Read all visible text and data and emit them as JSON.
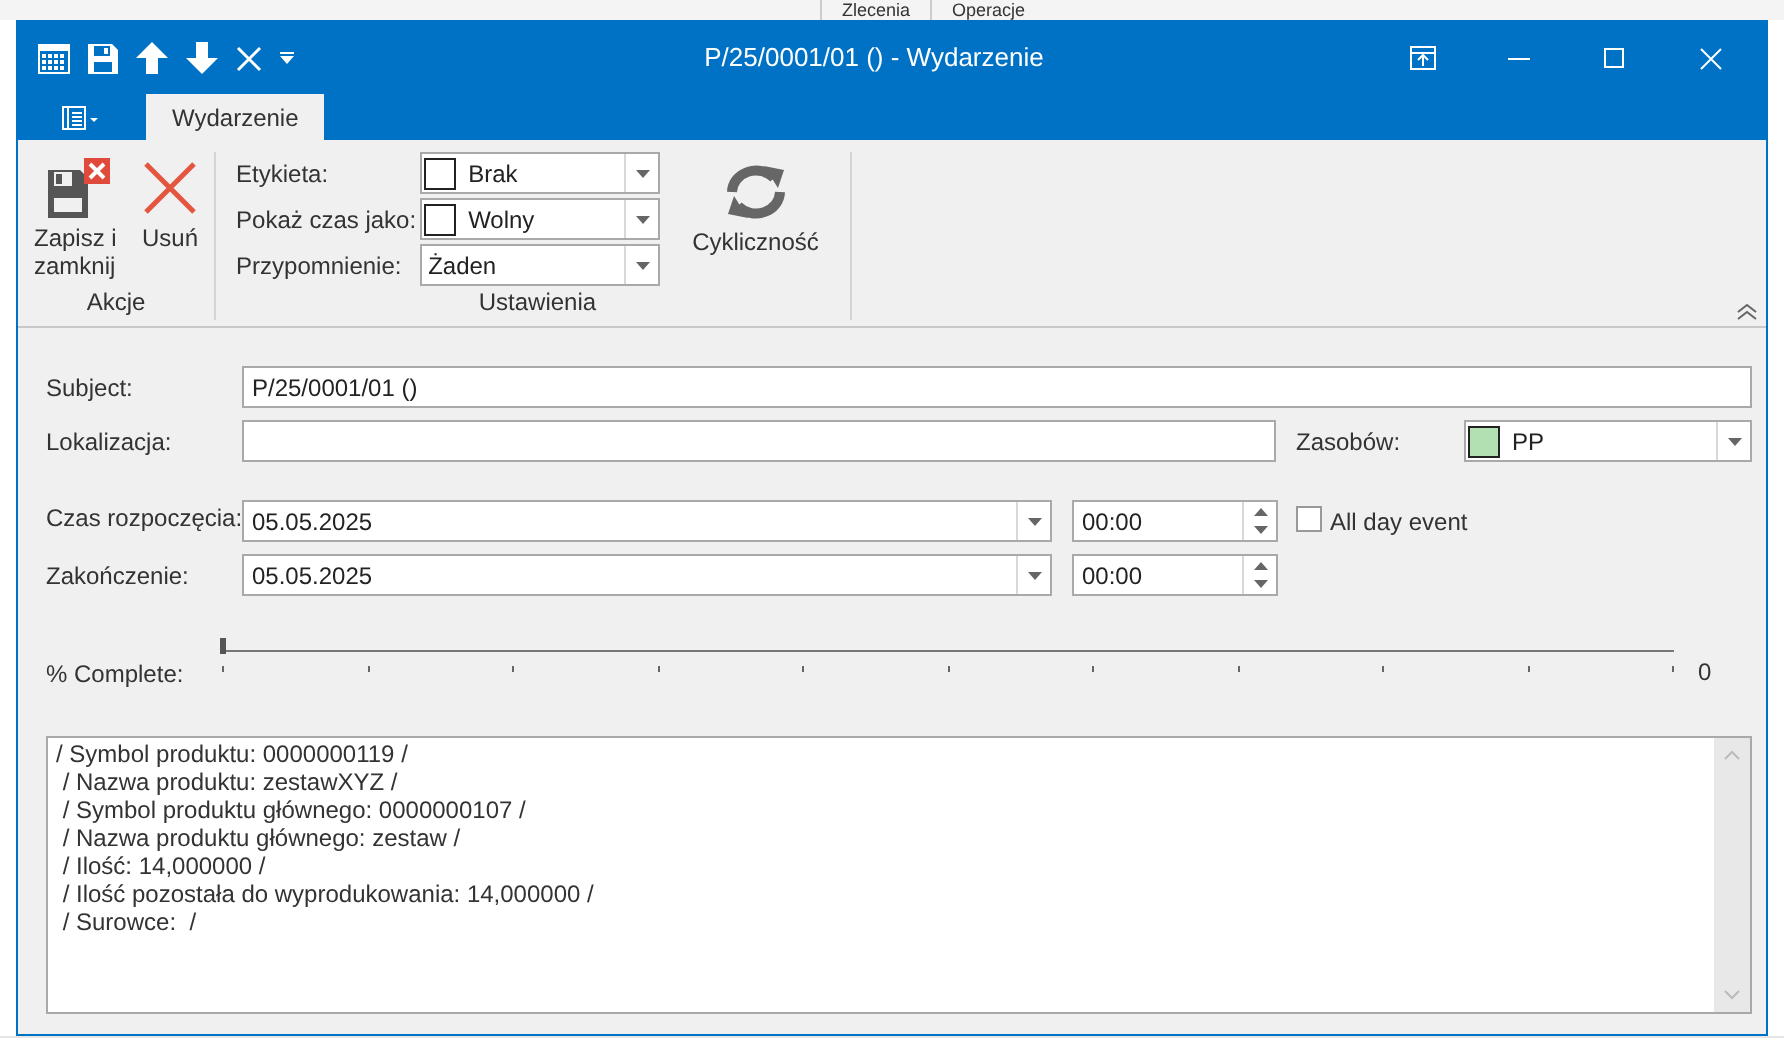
{
  "background": {
    "tabs": [
      "Zlecenia",
      "Operacje"
    ]
  },
  "window": {
    "title": "P/25/0001/01 () - Wydarzenie"
  },
  "ribbon": {
    "tabs": [
      {
        "label": "Wydarzenie",
        "selected": true
      }
    ],
    "groups": [
      {
        "title": "Akcje",
        "buttons": [
          {
            "kind": "save-close",
            "label": "Zapisz i zamknij"
          },
          {
            "kind": "delete",
            "label": "Usuń"
          }
        ]
      },
      {
        "title": "Ustawienia",
        "fields": [
          {
            "label": "Etykieta:",
            "value": "Brak",
            "kind": "swatch"
          },
          {
            "label": "Pokaż czas jako:",
            "value": "Wolny",
            "kind": "swatch"
          },
          {
            "label": "Przypomnienie:",
            "value": "Żaden",
            "kind": "plain"
          }
        ],
        "buttons": [
          {
            "kind": "recurrence",
            "label": "Cykliczność"
          }
        ]
      }
    ]
  },
  "form": {
    "subject": {
      "label": "Subject:",
      "value": "P/25/0001/01 ()"
    },
    "location": {
      "label": "Lokalizacja:"
    },
    "resource": {
      "label": "Zasobów:",
      "value": "PP",
      "color": "#b3e0b3"
    },
    "start": {
      "label": "Czas rozpoczęcia:",
      "date": "05.05.2025",
      "time": "00:00"
    },
    "end": {
      "label": "Zakończenie:",
      "date": "05.05.2025",
      "time": "00:00"
    },
    "all_day": {
      "label": "All day event",
      "checked": false
    },
    "progress": {
      "label": "% Complete:",
      "level": 0,
      "reading": "0"
    },
    "notes": [
      "/ Symbol produktu: 0000000119 /",
      " / Nazwa produktu: zestawXYZ /",
      " / Symbol produktu głównego: 0000000107 /",
      " / Nazwa produktu głównego: zestaw /",
      " / Ilość: 14,000000 /",
      " / Ilość pozostała do wyprodukowania: 14,000000 /",
      " / Surowce:  /"
    ]
  }
}
